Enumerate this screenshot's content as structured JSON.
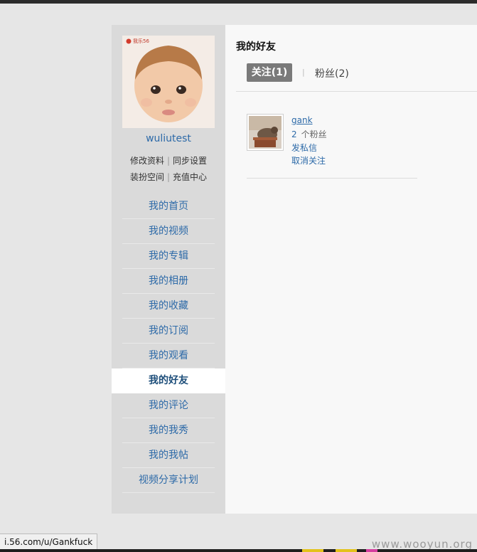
{
  "sidebar": {
    "avatar_logo": "我乐56",
    "username": "wuliutest",
    "profile_links": [
      "修改资料",
      "同步设置"
    ],
    "space_links": [
      "装扮空间",
      "充值中心"
    ],
    "nav": [
      {
        "label": "我的首页"
      },
      {
        "label": "我的视频"
      },
      {
        "label": "我的专辑"
      },
      {
        "label": "我的相册"
      },
      {
        "label": "我的收藏"
      },
      {
        "label": "我的订阅"
      },
      {
        "label": "我的观看"
      },
      {
        "label": "我的好友",
        "active": true
      },
      {
        "label": "我的评论"
      },
      {
        "label": "我的我秀"
      },
      {
        "label": "我的我帖"
      },
      {
        "label": "视频分享计划"
      }
    ]
  },
  "main": {
    "title": "我的好友",
    "tabs": {
      "following": "关注(1)",
      "fans": "粉丝(2)"
    },
    "friends": [
      {
        "name": "gank",
        "fans_count": "2",
        "fans_label": "个粉丝",
        "message": "发私信",
        "unfollow": "取消关注"
      }
    ]
  },
  "statusbar": {
    "url": "i.56.com/u/Gankfuck"
  },
  "watermark": "www.wooyun.org",
  "colors": {
    "link": "#2d6aa8",
    "sidebar_bg": "#dadada",
    "active_tab_bg": "#7a7a7a"
  }
}
